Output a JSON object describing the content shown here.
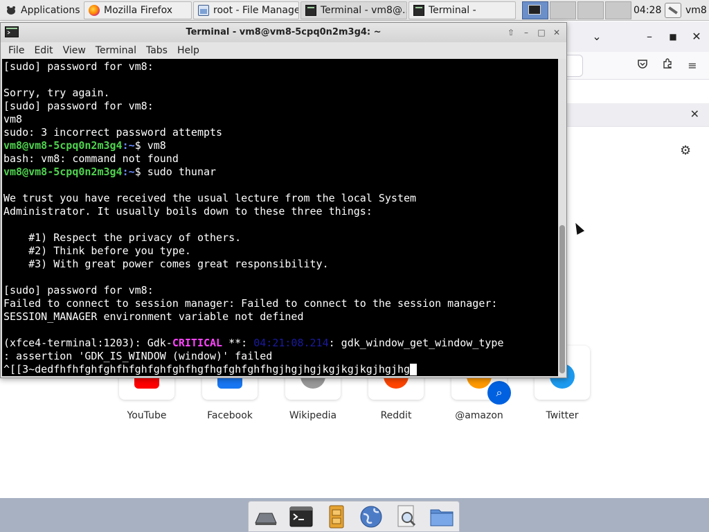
{
  "top_panel": {
    "applications_label": "Applications",
    "tasks": [
      {
        "label": "Mozilla Firefox",
        "icon": "firefox-icon",
        "active": false
      },
      {
        "label": "root - File Manager",
        "icon": "file-manager-icon",
        "active": false
      },
      {
        "label": "Terminal - vm8@...",
        "icon": "terminal-icon",
        "active": true
      },
      {
        "label": "Terminal -",
        "icon": "terminal-icon",
        "active": false
      }
    ],
    "clock": "04:28",
    "user": "vm8"
  },
  "terminal": {
    "title": "Terminal - vm8@vm8-5cpq0n2m3g4: ~",
    "menu": [
      "File",
      "Edit",
      "View",
      "Terminal",
      "Tabs",
      "Help"
    ],
    "prompt_user": "vm8@vm8-5cpq0n2m3g4",
    "prompt_path": ":~",
    "lines": [
      "[sudo] password for vm8:",
      "",
      "Sorry, try again.",
      "[sudo] password for vm8:",
      "vm8",
      "sudo: 3 incorrect password attempts",
      "$ vm8",
      "bash: vm8: command not found",
      "$ sudo thunar",
      "",
      "We trust you have received the usual lecture from the local System",
      "Administrator. It usually boils down to these three things:",
      "",
      "    #1) Respect the privacy of others.",
      "    #2) Think before you type.",
      "    #3) With great power comes great responsibility.",
      "",
      "[sudo] password for vm8:",
      "Failed to connect to session manager: Failed to connect to the session manager:",
      "SESSION_MANAGER environment variable not defined",
      "",
      "(xfce4-terminal:1203): Gdk-",
      "CRITICAL",
      " **: ",
      "04:21:08.214",
      ": gdk_window_get_window_type",
      ": assertion 'GDK_IS_WINDOW (window)' failed",
      "^[[3~dedfhfhfghfghfhfghfghfghfhgfhgfghfghfhgjhgjhgjkgjkgjkgjhgjhg"
    ]
  },
  "firefox": {
    "shortcuts": [
      {
        "label": "YouTube",
        "color": "#ff0000"
      },
      {
        "label": "Facebook",
        "color": "#1877f2"
      },
      {
        "label": "Wikipedia",
        "color": "#9a9a9a"
      },
      {
        "label": "Reddit",
        "color": "#ff4500"
      },
      {
        "label": "@amazon",
        "color": "#ff9900"
      },
      {
        "label": "Twitter",
        "color": "#1d9bf0"
      }
    ]
  },
  "dock": {
    "items": [
      "show-desktop-icon",
      "terminal-icon",
      "file-cabinet-icon",
      "web-browser-icon",
      "search-icon",
      "folder-icon"
    ]
  }
}
